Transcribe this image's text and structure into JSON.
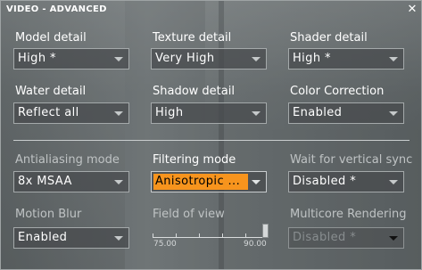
{
  "window": {
    "title": "VIDEO - ADVANCED"
  },
  "settings": {
    "model_detail": {
      "label": "Model detail",
      "value": "High  *"
    },
    "texture_detail": {
      "label": "Texture detail",
      "value": "Very High"
    },
    "shader_detail": {
      "label": "Shader detail",
      "value": "High  *"
    },
    "water_detail": {
      "label": "Water detail",
      "value": "Reflect all"
    },
    "shadow_detail": {
      "label": "Shadow detail",
      "value": "High"
    },
    "color_correction": {
      "label": "Color Correction",
      "value": "Enabled"
    },
    "antialiasing_mode": {
      "label": "Antialiasing mode",
      "value": "8x MSAA"
    },
    "filtering_mode": {
      "label": "Filtering mode",
      "value": "Anisotropic ..."
    },
    "wait_vsync": {
      "label": "Wait for vertical sync",
      "value": "Disabled  *"
    },
    "motion_blur": {
      "label": "Motion Blur",
      "value": "Enabled"
    },
    "field_of_view": {
      "label": "Field of view",
      "min_label": "75.00",
      "max_label": "90.00",
      "value": 90
    },
    "multicore_rendering": {
      "label": "Multicore Rendering",
      "value": "Disabled  *"
    }
  },
  "colors": {
    "highlight": "#f7941d",
    "text": "#ffffff"
  },
  "icons": {
    "close": "close-icon",
    "dropdown": "chevron-down-icon"
  }
}
